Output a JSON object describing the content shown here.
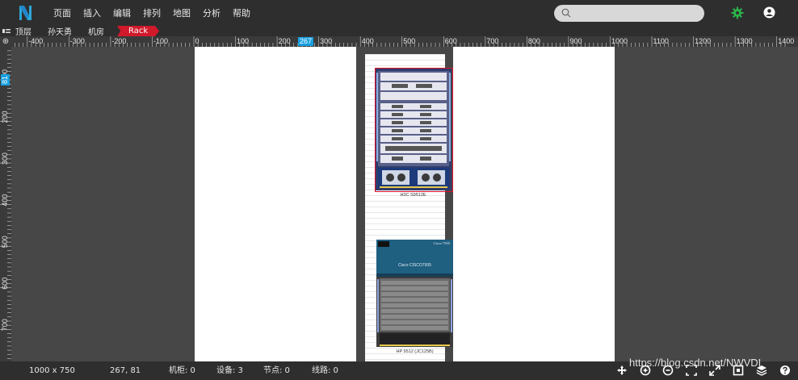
{
  "menu": [
    "页面",
    "插入",
    "编辑",
    "排列",
    "地图",
    "分析",
    "帮助"
  ],
  "search": {
    "placeholder": ""
  },
  "breadcrumb": [
    "顶层",
    "孙天勇",
    "机房",
    "Rack"
  ],
  "ruler": {
    "h_labels": [
      "-400",
      "-300",
      "-200",
      "-100",
      "0",
      "100",
      "200",
      "300",
      "400",
      "500",
      "600",
      "700",
      "800",
      "900",
      "1000",
      "1100",
      "1200",
      "1300",
      "1400"
    ],
    "h_marker": "267",
    "v_labels": [
      "100",
      "200",
      "300",
      "400",
      "500",
      "600",
      "700"
    ],
    "v_marker": "81",
    "corner": "⊕"
  },
  "devices": {
    "h3c_caption": "H3C S9512E",
    "cisco_label": "Cisco CISCO7505",
    "cisco_brand": "Cisco 7505",
    "hp_caption": "HP 9512 (JC125B)"
  },
  "status": {
    "size": "1000 x 750",
    "coords": "267, 81",
    "cabinets": "机柜: 0",
    "devices": "设备: 3",
    "nodes": "节点: 0",
    "links": "线路: 0"
  },
  "watermark": "https://blog.csdn.net/NWVDI",
  "colors": {
    "accent_red": "#d0192b",
    "ruler_marker": "#19a0e0",
    "gear_green": "#2bb34a",
    "cisco_blue": "#1f5f80"
  },
  "icons": [
    "logo-icon",
    "search-icon",
    "gear-icon",
    "user-icon",
    "menu-toggle-icon",
    "pan-icon",
    "zoom-in-icon",
    "zoom-out-icon",
    "fit-icon",
    "fullscreen-icon",
    "overview-icon",
    "layers-icon",
    "help-icon"
  ]
}
